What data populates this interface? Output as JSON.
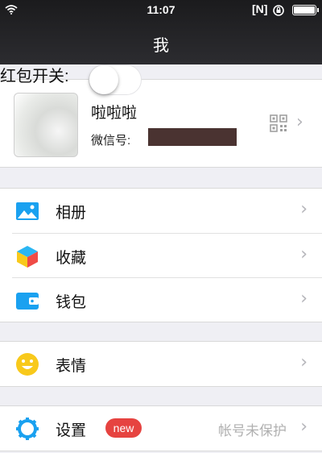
{
  "status_bar": {
    "time": "11:07",
    "badge": "[N]"
  },
  "header": {
    "title": "我"
  },
  "redpacket": {
    "label": "红包开关:",
    "toggle_on": false
  },
  "profile": {
    "name": "啦啦啦",
    "wechat_id_label": "微信号:"
  },
  "menu": {
    "album": "相册",
    "favorites": "收藏",
    "wallet": "钱包",
    "stickers": "表情",
    "settings": "设置",
    "settings_badge": "new",
    "settings_status": "帐号未保护"
  },
  "colors": {
    "header_bg": "#1b1b1d",
    "badge_red": "#e64340",
    "icon_blue": "#1aa1f0",
    "icon_yellow": "#f8c91b"
  }
}
